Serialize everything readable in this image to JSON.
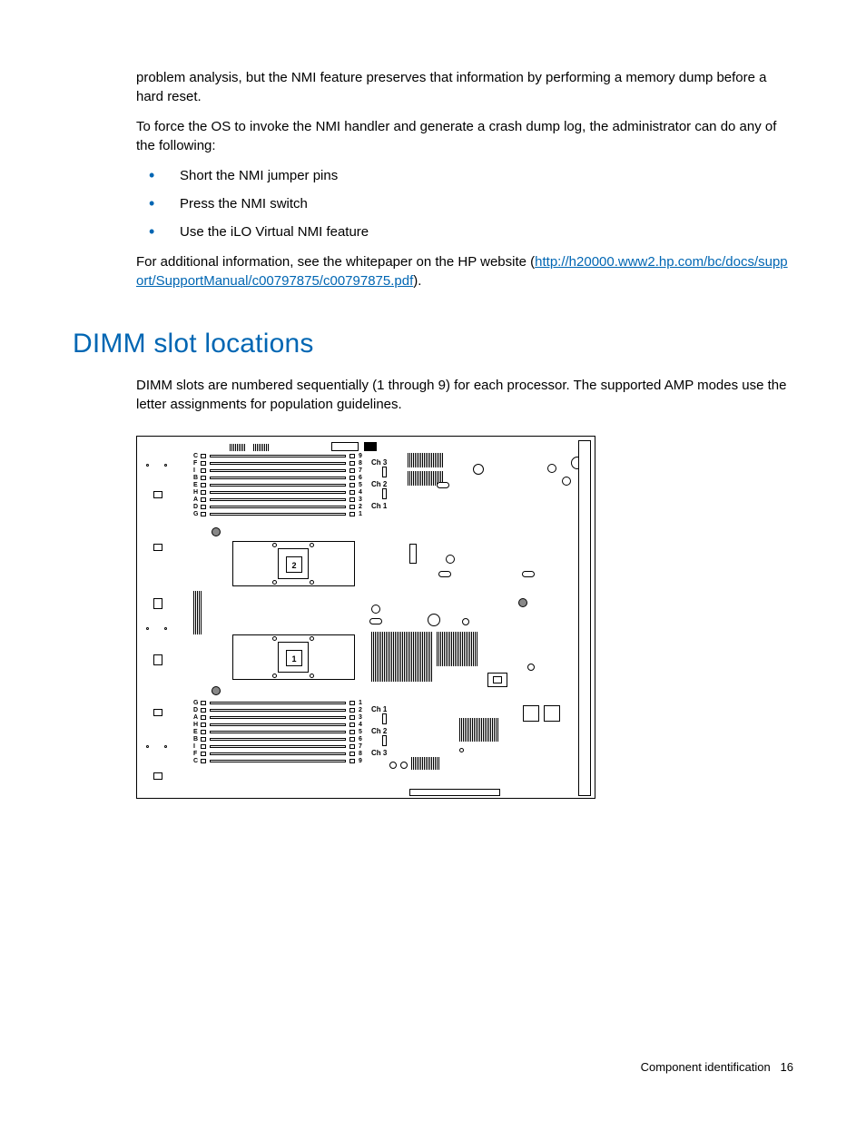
{
  "intro": {
    "p1": "problem analysis, but the NMI feature preserves that information by performing a memory dump before a hard reset.",
    "p2": "To force the OS to invoke the NMI handler and generate a crash dump log, the administrator can do any of the following:",
    "bullets": [
      "Short the NMI jumper pins",
      "Press the NMI switch",
      "Use the iLO Virtual NMI feature"
    ],
    "p3a": "For additional information, see the whitepaper on the HP website (",
    "link": "http://h20000.www2.hp.com/bc/docs/support/SupportManual/c00797875/c00797875.pdf",
    "p3b": ")."
  },
  "section": {
    "heading": "DIMM slot locations",
    "p1": "DIMM slots are numbered sequentially (1 through 9) for each processor. The supported AMP modes use the letter assignments for population guidelines."
  },
  "diagram": {
    "topSlots": [
      {
        "letter": "C",
        "num": "9"
      },
      {
        "letter": "F",
        "num": "8"
      },
      {
        "letter": "I",
        "num": "7"
      },
      {
        "letter": "B",
        "num": "6"
      },
      {
        "letter": "E",
        "num": "5"
      },
      {
        "letter": "H",
        "num": "4"
      },
      {
        "letter": "A",
        "num": "3"
      },
      {
        "letter": "D",
        "num": "2"
      },
      {
        "letter": "G",
        "num": "1"
      }
    ],
    "bottomSlots": [
      {
        "letter": "G",
        "num": "1"
      },
      {
        "letter": "D",
        "num": "2"
      },
      {
        "letter": "A",
        "num": "3"
      },
      {
        "letter": "H",
        "num": "4"
      },
      {
        "letter": "E",
        "num": "5"
      },
      {
        "letter": "B",
        "num": "6"
      },
      {
        "letter": "I",
        "num": "7"
      },
      {
        "letter": "F",
        "num": "8"
      },
      {
        "letter": "C",
        "num": "9"
      }
    ],
    "ch1": "Ch 1",
    "ch2": "Ch 2",
    "ch3": "Ch 3",
    "cpu1": "1",
    "cpu2": "2"
  },
  "footer": {
    "section": "Component identification",
    "page": "16"
  }
}
